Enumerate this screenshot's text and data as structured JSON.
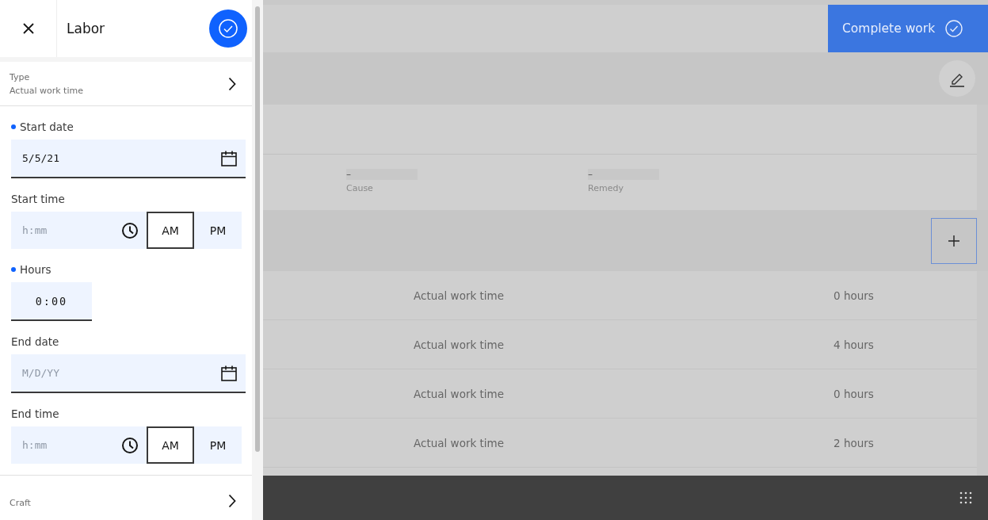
{
  "panel": {
    "title": "Labor",
    "type_row": {
      "label": "Type",
      "value": "Actual work time"
    },
    "fields": [
      {
        "kind": "date",
        "label": "Start date",
        "required": true,
        "value": "5/5/21"
      },
      {
        "kind": "time",
        "label": "Start time",
        "required": false,
        "placeholder": "h:mm",
        "periods": [
          {
            "label": "AM",
            "selected": true
          },
          {
            "label": "PM",
            "selected": false
          }
        ]
      },
      {
        "kind": "hours",
        "label": "Hours",
        "required": true,
        "value": "0:00"
      },
      {
        "kind": "date",
        "label": "End date",
        "required": false,
        "placeholder": "M/D/YY"
      },
      {
        "kind": "time",
        "label": "End time",
        "required": false,
        "placeholder": "h:mm",
        "periods": [
          {
            "label": "AM",
            "selected": true
          },
          {
            "label": "PM",
            "selected": false
          }
        ]
      }
    ],
    "craft_row": {
      "label": "Craft"
    }
  },
  "background": {
    "complete_button": "Complete work",
    "failure": [
      {
        "value": "–",
        "label": "Cause"
      },
      {
        "value": "–",
        "label": "Remedy"
      }
    ],
    "labor_rows": [
      {
        "type": "Actual work time",
        "hours": "0 hours"
      },
      {
        "type": "Actual work time",
        "hours": "4 hours"
      },
      {
        "type": "Actual work time",
        "hours": "0 hours"
      },
      {
        "type": "Actual work time",
        "hours": "2 hours"
      }
    ]
  }
}
